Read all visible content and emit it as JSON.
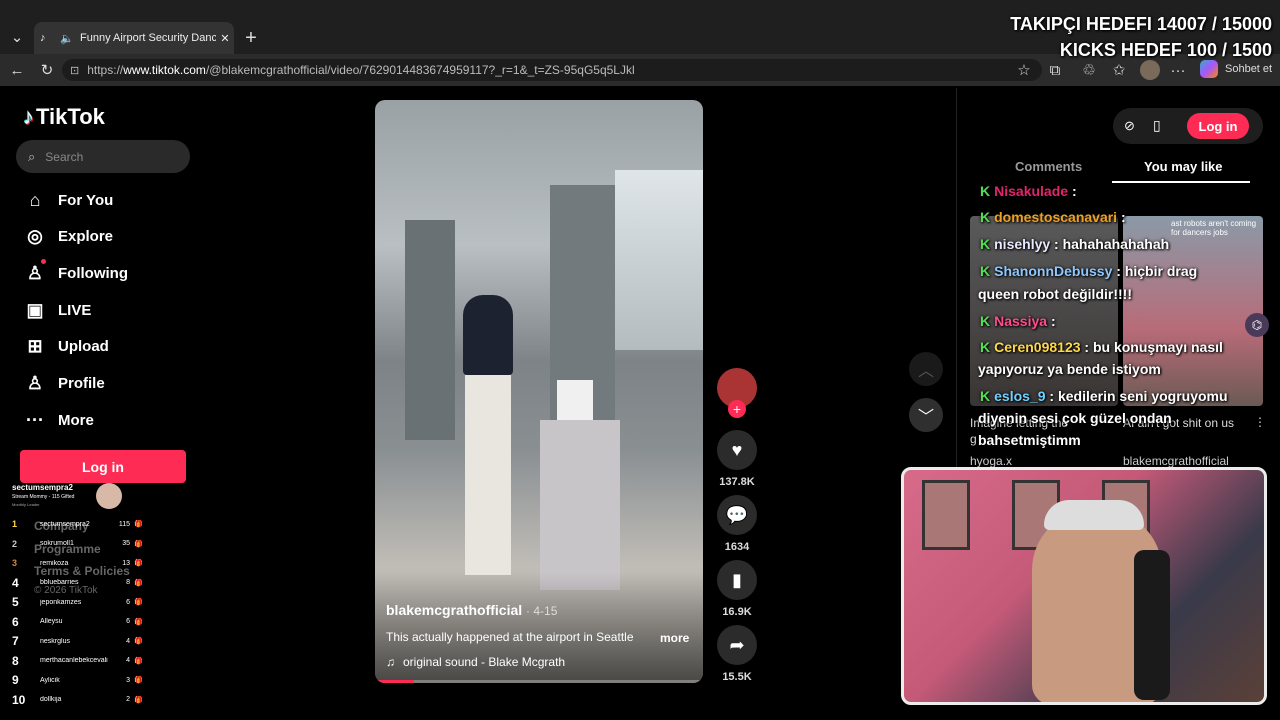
{
  "browser": {
    "tab_title": "Funny Airport Security Dance",
    "url_prefix": "https://",
    "url_host": "www.tiktok.com",
    "url_path": "/@blakemcgrathofficial/video/7629014483674959117?_r=1&_t=ZS-95qG5q5LJkl",
    "copilot_label": "Sohbet et"
  },
  "overlay": {
    "goal_line1": "TAKIPÇI HEDEFI 14007 / 15000",
    "goal_line2": "KICKS HEDEF 100 / 1500"
  },
  "sidebar": {
    "logo": "TikTok",
    "search_placeholder": "Search",
    "items": [
      {
        "label": "For You",
        "icon": "home-icon"
      },
      {
        "label": "Explore",
        "icon": "compass-icon"
      },
      {
        "label": "Following",
        "icon": "following-icon"
      },
      {
        "label": "LIVE",
        "icon": "live-icon"
      },
      {
        "label": "Upload",
        "icon": "upload-icon"
      },
      {
        "label": "Profile",
        "icon": "profile-icon"
      },
      {
        "label": "More",
        "icon": "more-icon"
      }
    ],
    "login_label": "Log in",
    "footer": [
      "Company",
      "Programme",
      "Terms & Policies",
      "© 2026 TikTok"
    ]
  },
  "video": {
    "author": "blakemcgrathofficial",
    "date": "· 4-15",
    "caption": "This actually happened at the airport in Seattle",
    "more_label": "more",
    "sound": "original sound - Blake Mcgrath",
    "progress": 0.12
  },
  "actions": {
    "likes": "137.8K",
    "comments": "1634",
    "saves": "16.9K",
    "shares": "15.5K"
  },
  "right_panel": {
    "login_label": "Log in",
    "tab_comments": "Comments",
    "tab_you_may_like": "You may like",
    "card1_caption": "Imagine letting the",
    "card1_caption_b": "g",
    "card1_author": "hyoga.x",
    "card2_caption": "AI ain't got shit on us",
    "card2_author": "blakemcgrathofficial",
    "card2_overlay_text": "ast robots aren't coming for dancers jobs"
  },
  "chat": [
    {
      "user": "Nisakulade",
      "msg": ":",
      "color": "#e0266b"
    },
    {
      "user": "domestoscanavari",
      "msg": ":",
      "color": "#f0a020"
    },
    {
      "user": "nisehlyy",
      "msg": ": hahahahahahah",
      "color": "#e8e8ff"
    },
    {
      "user": "ShanonnDebussy",
      "msg": ": hiçbir drag",
      "color": "#8fc8ff"
    },
    {
      "user": "",
      "msg": "queen robot değildir!!!!",
      "color": "#ffffff"
    },
    {
      "user": "Nassiya",
      "msg": ":",
      "color": "#ff4d8d"
    },
    {
      "user": "Ceren098123",
      "msg": ": bu konuşmayı nasıl",
      "color": "#ffd84a"
    },
    {
      "user": "",
      "msg": "yapıyoruz ya bende istiyom",
      "color": "#ffffff"
    },
    {
      "user": "eslos_9",
      "msg": ": kedilerin seni yogruyomu",
      "color": "#6fd0ff"
    },
    {
      "user": "",
      "msg": "diyenin sesi çok güzel ondan",
      "color": "#ffffff"
    },
    {
      "user": "",
      "msg": "bahsetmiştimm",
      "color": "#ffffff"
    }
  ],
  "leaderboard": {
    "top_user": "sectumsempra2",
    "top_sub": "Stream Mommy - 115 Gifted",
    "top_sub2": "Monthly Leader",
    "rows": [
      {
        "rank": "1",
        "name": "sectumsempra2",
        "count": "115"
      },
      {
        "rank": "2",
        "name": "sokrumoll1",
        "count": "35"
      },
      {
        "rank": "3",
        "name": "remikoza",
        "count": "13"
      },
      {
        "rank": "4",
        "name": "bbluebarries",
        "count": "8"
      },
      {
        "rank": "5",
        "name": "jeponkamzes",
        "count": "6"
      },
      {
        "rank": "6",
        "name": "Alleysu",
        "count": "6"
      },
      {
        "rank": "7",
        "name": "neskrglus",
        "count": "4"
      },
      {
        "rank": "8",
        "name": "merthacanlebekcevali",
        "count": "4"
      },
      {
        "rank": "9",
        "name": "Aylicik",
        "count": "3"
      },
      {
        "rank": "10",
        "name": "dollkija",
        "count": "2"
      }
    ]
  }
}
